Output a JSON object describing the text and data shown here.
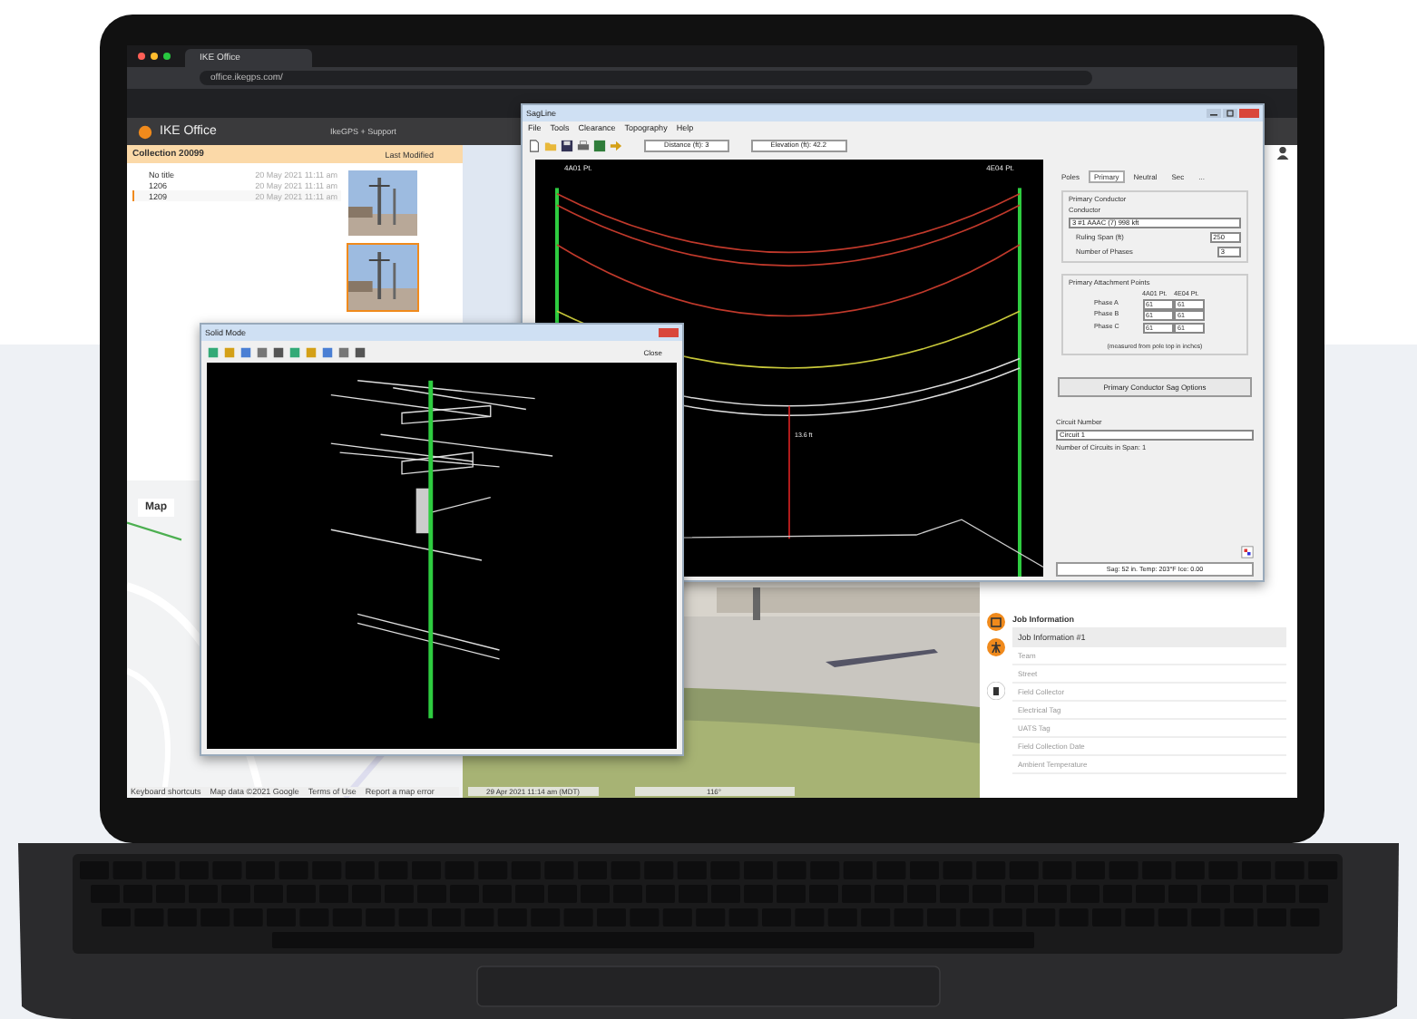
{
  "browser": {
    "tab_title": "IKE Office",
    "url": "office.ikegps.com/"
  },
  "app": {
    "title": "IKE Office",
    "support": "IkeGPS + Support"
  },
  "collection": {
    "title": "Collection 20099",
    "sort": "Last Modified",
    "items": [
      {
        "name": "No title",
        "date": "20 May 2021 11:11 am",
        "selected": false
      },
      {
        "name": "1206",
        "date": "20 May 2021 11:11 am",
        "selected": false
      },
      {
        "name": "1209",
        "date": "20 May 2021 11:11 am",
        "selected": true
      }
    ]
  },
  "photos": [
    {
      "kind": "picture",
      "selected": false
    },
    {
      "kind": "picture",
      "selected": true
    }
  ],
  "map": {
    "tab": "Map",
    "attribution": [
      "Keyboard shortcuts",
      "Map data ©2021 Google",
      "Terms of Use",
      "Report a map error"
    ]
  },
  "street_view": {
    "timestamp": "29 Apr 2021 11:14 am (MDT)",
    "heading": "116°"
  },
  "sagline": {
    "title": "SagLine",
    "menu": [
      "File",
      "Tools",
      "Clearance",
      "Topography",
      "Help"
    ],
    "distance": "Distance (ft): 3",
    "elevation": "Elevation (ft): 42.2",
    "left_pole": "4A01 Pt.",
    "right_pole": "4E04 Pt.",
    "span_label": "13.6 ft",
    "tabs": [
      {
        "label": "Poles",
        "selected": false
      },
      {
        "label": "Primary",
        "selected": true
      },
      {
        "label": "Neutral",
        "selected": false
      },
      {
        "label": "Sec",
        "selected": false
      },
      {
        "label": "...",
        "selected": false
      }
    ],
    "conductor_group": "Primary Conductor",
    "conductor_label": "Conductor",
    "conductor": "3 #1 AAAC (7) 998 kft",
    "span_label_text": "Ruling Span (ft)",
    "span_value": "250",
    "phases_label": "Number of Phases",
    "phases_value": "3",
    "attach_group": "Primary Attachment Points",
    "attach_columns": [
      "4A01 Pt.",
      "4E04 Pt."
    ],
    "attach_rows": [
      {
        "phase": "Phase A",
        "a": "61",
        "b": "61"
      },
      {
        "phase": "Phase B",
        "a": "61",
        "b": "61"
      },
      {
        "phase": "Phase C",
        "a": "61",
        "b": "61"
      }
    ],
    "attach_note": "(measured from pole top in inches)",
    "sag_button": "Primary Conductor Sag Options",
    "circuit_label": "Circuit Number",
    "circuit_value": "Circuit 1",
    "circuit_count": "Number of Circuits in Span: 1",
    "status": "Sag: 52 in.   Temp: 203°F   Ice: 0.00"
  },
  "solid_mode": {
    "title": "Solid Mode",
    "close": "Close"
  },
  "job": {
    "section": "Job Information",
    "item": "Job Information #1",
    "fields": [
      "Team",
      "Street",
      "Field Collector",
      "Electrical Tag",
      "UATS Tag",
      "Field Collection Date",
      "Ambient Temperature"
    ]
  }
}
